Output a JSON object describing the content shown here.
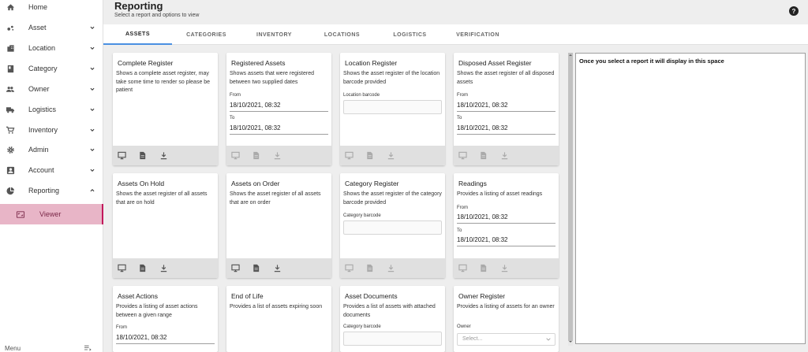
{
  "sidebar": {
    "items": [
      {
        "label": "Home",
        "icon": "home-icon"
      },
      {
        "label": "Asset",
        "icon": "asset-icon"
      },
      {
        "label": "Location",
        "icon": "location-icon"
      },
      {
        "label": "Category",
        "icon": "category-icon"
      },
      {
        "label": "Owner",
        "icon": "owner-icon"
      },
      {
        "label": "Logistics",
        "icon": "truck-icon"
      },
      {
        "label": "Inventory",
        "icon": "cart-icon"
      },
      {
        "label": "Admin",
        "icon": "gear-icon"
      },
      {
        "label": "Account",
        "icon": "account-icon"
      },
      {
        "label": "Reporting",
        "icon": "pie-chart-icon"
      }
    ],
    "viewer_label": "Viewer",
    "menu_label": "Menu"
  },
  "header": {
    "title": "Reporting",
    "subtitle": "Select a report and options to view",
    "help": "?"
  },
  "tabs": [
    "ASSETS",
    "CATEGORIES",
    "INVENTORY",
    "LOCATIONS",
    "LOGISTICS",
    "VERIFICATION"
  ],
  "cards": {
    "complete_register": {
      "title": "Complete Register",
      "desc": "Shows a complete asset register, may take some time to render so please be patient"
    },
    "registered_assets": {
      "title": "Registered Assets",
      "desc": "Shows assets that were registered between two supplied dates",
      "from_label": "From",
      "from_value": "18/10/2021, 08:32",
      "to_label": "To",
      "to_value": "18/10/2021, 08:32"
    },
    "location_register": {
      "title": "Location Register",
      "desc": "Shows the asset register of the location barcode provided",
      "field_label": "Location barcode"
    },
    "disposed_register": {
      "title": "Disposed Asset Register",
      "desc": "Shows the asset register of all disposed assets",
      "from_label": "From",
      "from_value": "18/10/2021, 08:32",
      "to_label": "To",
      "to_value": "18/10/2021, 08:32"
    },
    "assets_on_hold": {
      "title": "Assets On Hold",
      "desc": "Shows the asset register of all assets that are on hold"
    },
    "assets_on_order": {
      "title": "Assets on Order",
      "desc": "Shows the asset register of all assets that are on order"
    },
    "category_register": {
      "title": "Category Register",
      "desc": "Shows the asset register of the category barcode provided",
      "field_label": "Category barcode"
    },
    "readings": {
      "title": "Readings",
      "desc": "Provides a listing of asset readings",
      "from_label": "From",
      "from_value": "18/10/2021, 08:32",
      "to_label": "To",
      "to_value": "18/10/2021, 08:32"
    },
    "asset_actions": {
      "title": "Asset Actions",
      "desc": "Provides a listing of asset actions between a given range",
      "from_label": "From",
      "from_value": "18/10/2021, 08:32"
    },
    "end_of_life": {
      "title": "End of Life",
      "desc": "Provides a list of assets expiring soon"
    },
    "asset_documents": {
      "title": "Asset Documents",
      "desc": "Provides a list of assets with attached documents",
      "field_label": "Category barcode"
    },
    "owner_register": {
      "title": "Owner Register",
      "desc": "Provides a listing of assets for an owner",
      "field_label": "Owner",
      "placeholder": "Select..."
    }
  },
  "viewer": {
    "message": "Once you select a report it will display in this space"
  },
  "colors": {
    "accent": "#4a90e2",
    "active_nav": "#e8b5c7",
    "card_footer": "#e0e0e0"
  }
}
